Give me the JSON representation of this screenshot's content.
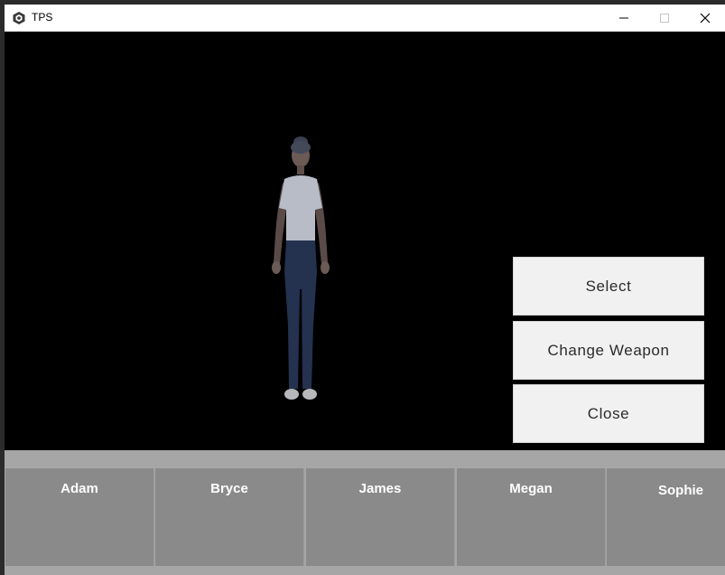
{
  "window": {
    "title": "TPS",
    "controls": {
      "minimize": "minimize-icon",
      "maximize": "maximize-icon",
      "close": "close-icon"
    }
  },
  "actions": {
    "select": "Select",
    "change_weapon": "Change Weapon",
    "close": "Close"
  },
  "characters": [
    "Adam",
    "Bryce",
    "James",
    "Megan",
    "Sophie"
  ],
  "colors": {
    "viewport_bg": "#000000",
    "button_bg": "#f1f1f1",
    "strip_bg": "#a6a6a6",
    "card_bg": "#8a8a8a"
  }
}
